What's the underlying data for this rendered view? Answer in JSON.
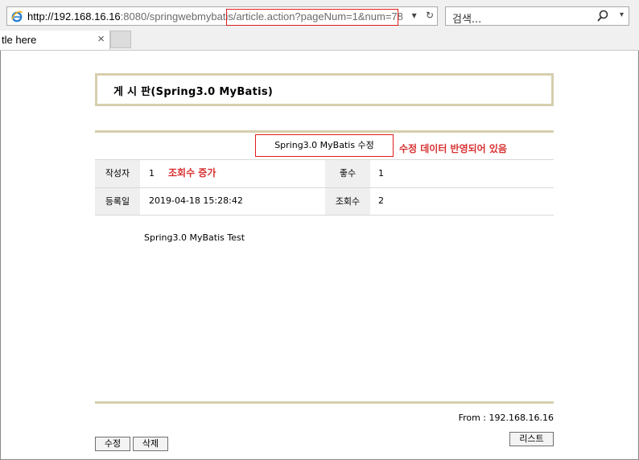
{
  "browser": {
    "url_host": "http://192.168.16.16",
    "url_path": ":8080/springwebmybatis/article.action?pageNum=1&num=78",
    "search_placeholder": "검색...",
    "tab_title": "tle here",
    "tab_close": "×"
  },
  "board": {
    "title": "게 시 판(Spring3.0 MyBatis)"
  },
  "article": {
    "subject": "Spring3.0 MyBatis 수정",
    "subject_note": "수정 데이터 반영되어 있음",
    "writer_label": "작성자",
    "writer": "1",
    "views_note": "조회수 증가",
    "recommend_label": "좋수",
    "recommend": "1",
    "date_label": "등록일",
    "date": "2019-04-18 15:28:42",
    "hits_label": "조회수",
    "hits": "2",
    "content": "Spring3.0 MyBatis Test",
    "from": "From : 192.168.16.16"
  },
  "buttons": {
    "edit": "수정",
    "delete": "삭제",
    "list": "리스트"
  },
  "colors": {
    "accent_border": "#d6cfae",
    "highlight_red": "#e01b1b",
    "note_red": "#d93030"
  }
}
